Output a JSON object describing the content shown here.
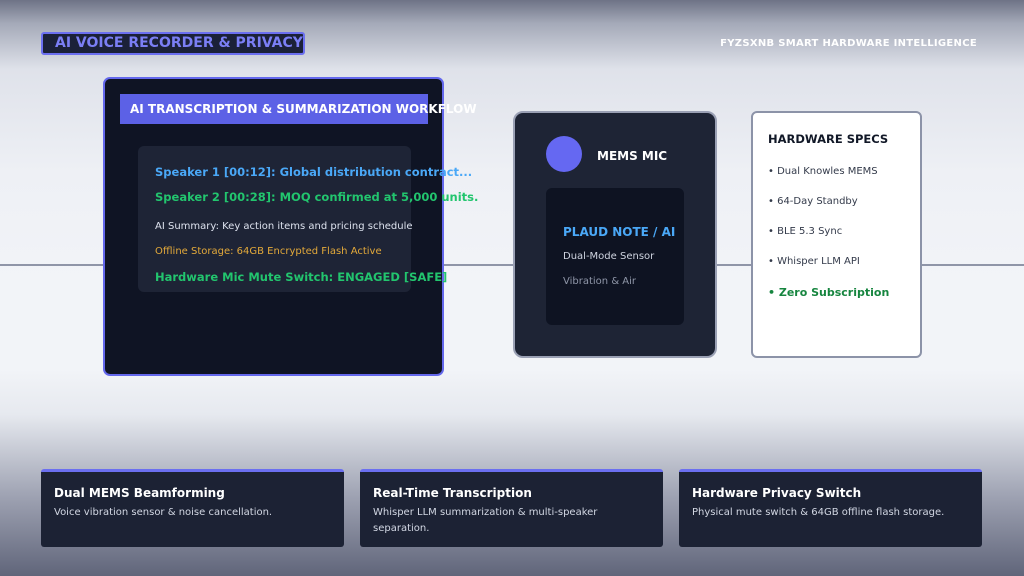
{
  "header": {
    "badge": "AI VOICE RECORDER & PRIVACY",
    "brand": "FYZSXNB SMART HARDWARE INTELLIGENCE"
  },
  "workflow": {
    "title": "AI TRANSCRIPTION & SUMMARIZATION WORKFLOW",
    "lines": [
      "Speaker 1 [00:12]: Global distribution contract...",
      "Speaker 2 [00:28]: MOQ confirmed at 5,000 units.",
      "AI Summary: Key action items and pricing schedule",
      "Offline Storage: 64GB Encrypted Flash Active",
      "Hardware Mic Mute Switch: ENGAGED [SAFE]"
    ]
  },
  "mic": {
    "title": "MEMS MIC",
    "product": "PLAUD NOTE / AI",
    "sensor": "Dual-Mode Sensor",
    "mode": "Vibration & Air",
    "accent": "#6568f2"
  },
  "specs": {
    "title": "HARDWARE SPECS",
    "items": [
      "• Dual Knowles MEMS",
      "• 64-Day Standby",
      "• BLE 5.3 Sync",
      "• Whisper LLM API",
      "• Zero Subscription"
    ]
  },
  "features": [
    {
      "title": "Dual MEMS Beamforming",
      "desc": "Voice vibration sensor & noise cancellation."
    },
    {
      "title": "Real-Time Transcription",
      "desc": "Whisper LLM summarization & multi-speaker separation."
    },
    {
      "title": "Hardware Privacy Switch",
      "desc": "Physical mute switch & 64GB offline flash storage."
    }
  ],
  "colors": {
    "accent": "#6b6ff0",
    "speaker1": "#4aa8f7",
    "success": "#22c56e",
    "storage": "#e3a93a",
    "zero_subscription": "#16853f"
  }
}
